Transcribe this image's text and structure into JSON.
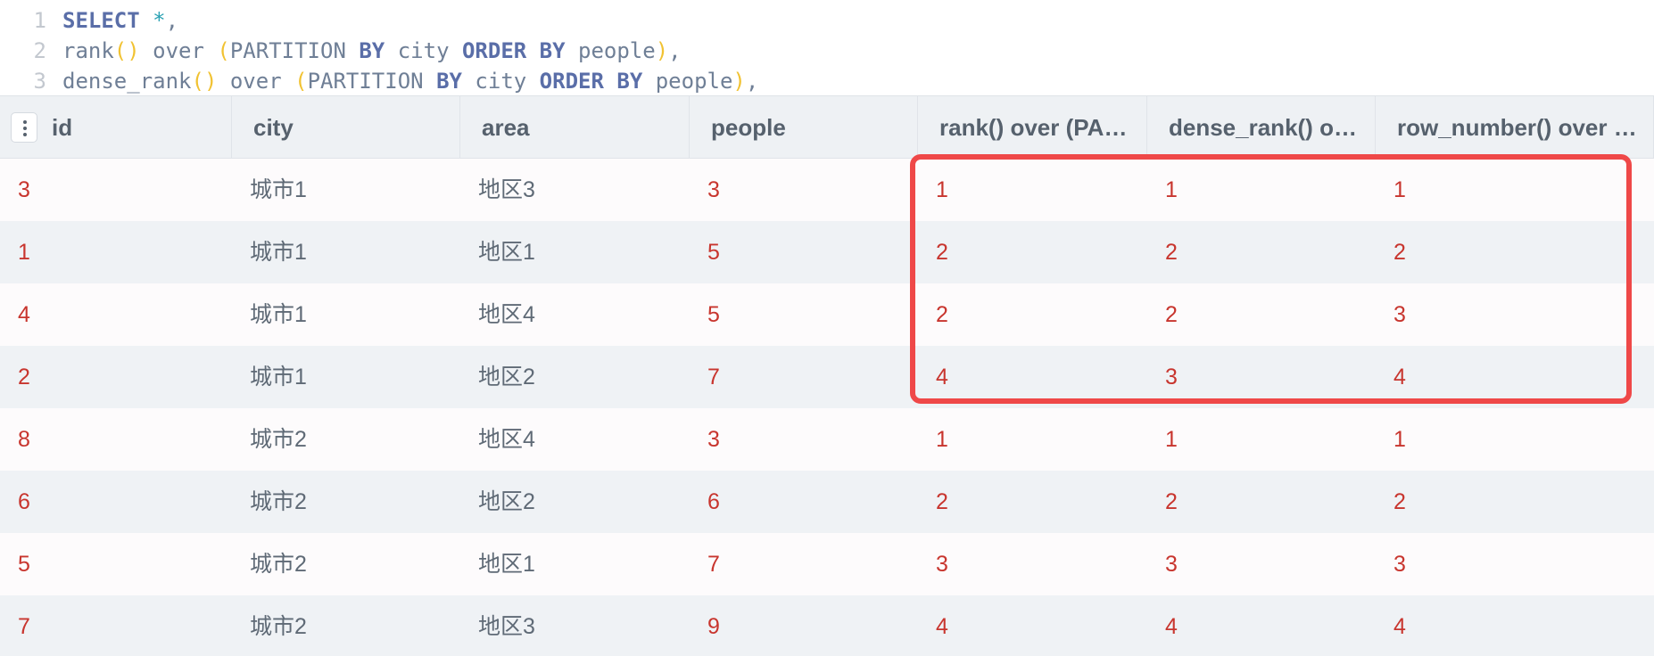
{
  "editor": {
    "lines": [
      {
        "number": "1",
        "tokens": [
          [
            "kw",
            "SELECT"
          ],
          [
            "plain",
            " "
          ],
          [
            "op",
            "*"
          ],
          [
            "plain",
            ","
          ]
        ]
      },
      {
        "number": "2",
        "tokens": [
          [
            "plain",
            "rank"
          ],
          [
            "paren",
            "()"
          ],
          [
            "plain",
            " over "
          ],
          [
            "paren",
            "("
          ],
          [
            "plain",
            "PARTITION "
          ],
          [
            "kw",
            "BY"
          ],
          [
            "plain",
            " city "
          ],
          [
            "kw",
            "ORDER BY"
          ],
          [
            "plain",
            " people"
          ],
          [
            "paren",
            ")"
          ],
          [
            "plain",
            ","
          ]
        ]
      },
      {
        "number": "3",
        "tokens": [
          [
            "plain",
            "dense_rank"
          ],
          [
            "paren",
            "()"
          ],
          [
            "plain",
            " over "
          ],
          [
            "paren",
            "("
          ],
          [
            "plain",
            "PARTITION "
          ],
          [
            "kw",
            "BY"
          ],
          [
            "plain",
            " city "
          ],
          [
            "kw",
            "ORDER BY"
          ],
          [
            "plain",
            " people"
          ],
          [
            "paren",
            ")"
          ],
          [
            "plain",
            ","
          ]
        ]
      }
    ]
  },
  "grid": {
    "columns": [
      {
        "key": "id",
        "label": "id"
      },
      {
        "key": "city",
        "label": "city"
      },
      {
        "key": "area",
        "label": "area"
      },
      {
        "key": "people",
        "label": "people"
      },
      {
        "key": "rank",
        "label": "rank() over (PA…"
      },
      {
        "key": "dense_rank",
        "label": "dense_rank() o…"
      },
      {
        "key": "row_number",
        "label": "row_number() over …"
      }
    ],
    "rows": [
      [
        "3",
        "城市1",
        "地区3",
        "3",
        "1",
        "1",
        "1"
      ],
      [
        "1",
        "城市1",
        "地区1",
        "5",
        "2",
        "2",
        "2"
      ],
      [
        "4",
        "城市1",
        "地区4",
        "5",
        "2",
        "2",
        "3"
      ],
      [
        "2",
        "城市1",
        "地区2",
        "7",
        "4",
        "3",
        "4"
      ],
      [
        "8",
        "城市2",
        "地区4",
        "3",
        "1",
        "1",
        "1"
      ],
      [
        "6",
        "城市2",
        "地区2",
        "6",
        "2",
        "2",
        "2"
      ],
      [
        "5",
        "城市2",
        "地区1",
        "7",
        "3",
        "3",
        "3"
      ],
      [
        "7",
        "城市2",
        "地区3",
        "9",
        "4",
        "4",
        "4"
      ]
    ],
    "text_columns": [
      "city",
      "area"
    ],
    "colors": {
      "number": "#c8352e",
      "text": "#5f6a76",
      "highlight_border": "#ef4848"
    }
  }
}
